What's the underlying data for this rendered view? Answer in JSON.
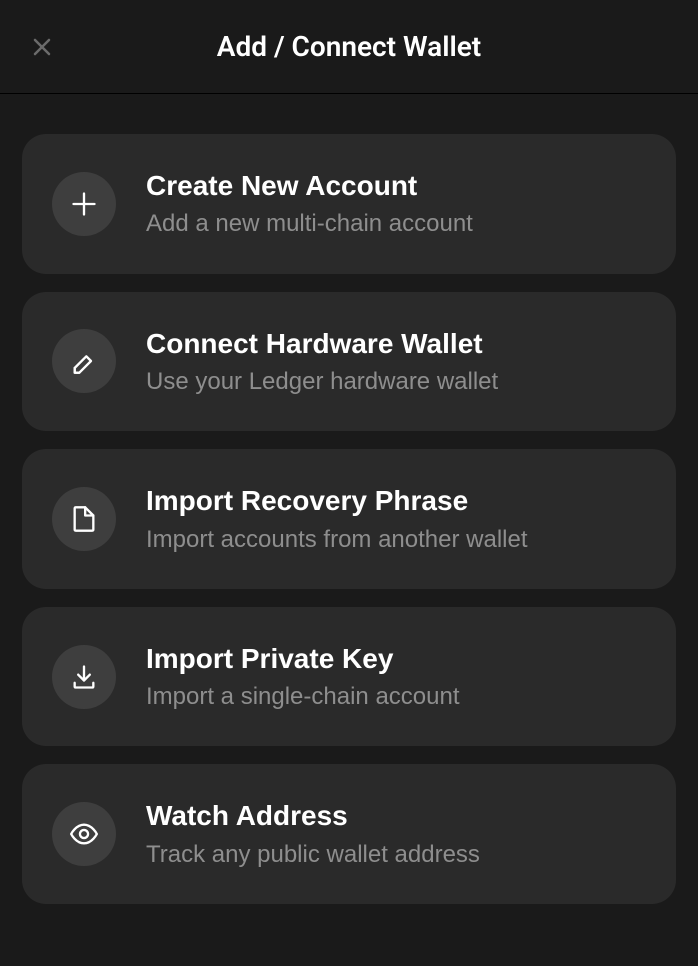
{
  "header": {
    "title": "Add / Connect Wallet"
  },
  "options": [
    {
      "name": "create-new-account",
      "icon": "plus-icon",
      "title": "Create New Account",
      "subtitle": "Add a new multi-chain account"
    },
    {
      "name": "connect-hardware-wallet",
      "icon": "ledger-icon",
      "title": "Connect Hardware Wallet",
      "subtitle": "Use your Ledger hardware wallet"
    },
    {
      "name": "import-recovery-phrase",
      "icon": "file-icon",
      "title": "Import Recovery Phrase",
      "subtitle": "Import accounts from another wallet"
    },
    {
      "name": "import-private-key",
      "icon": "download-icon",
      "title": "Import Private Key",
      "subtitle": "Import a single-chain account"
    },
    {
      "name": "watch-address",
      "icon": "eye-icon",
      "title": "Watch Address",
      "subtitle": "Track any public wallet address"
    }
  ]
}
